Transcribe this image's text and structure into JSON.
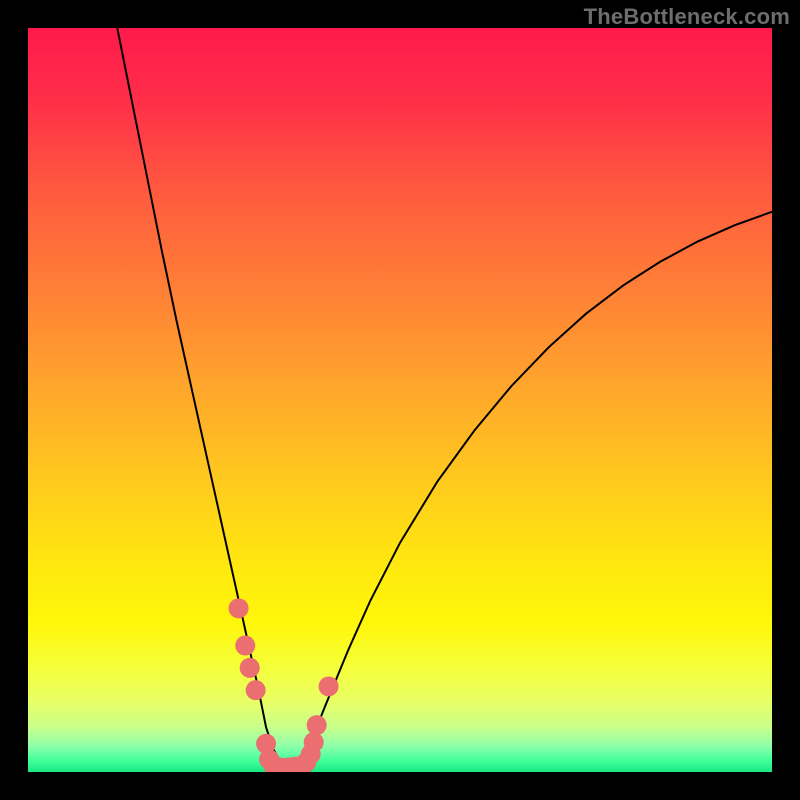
{
  "watermark": "TheBottleneck.com",
  "chart_data": {
    "type": "line",
    "title": "",
    "xlabel": "",
    "ylabel": "",
    "xlim": [
      0,
      100
    ],
    "ylim": [
      0,
      100
    ],
    "grid": false,
    "legend": false,
    "background_gradient": {
      "stops": [
        {
          "offset": 0.0,
          "color": "#ff1a4b"
        },
        {
          "offset": 0.1,
          "color": "#ff2f49"
        },
        {
          "offset": 0.22,
          "color": "#ff5a3f"
        },
        {
          "offset": 0.35,
          "color": "#ff7f36"
        },
        {
          "offset": 0.48,
          "color": "#ffa52c"
        },
        {
          "offset": 0.6,
          "color": "#ffc71f"
        },
        {
          "offset": 0.72,
          "color": "#ffe80f"
        },
        {
          "offset": 0.8,
          "color": "#fff70a"
        },
        {
          "offset": 0.86,
          "color": "#f5ff3a"
        },
        {
          "offset": 0.905,
          "color": "#e8ff66"
        },
        {
          "offset": 0.94,
          "color": "#c9ff8a"
        },
        {
          "offset": 0.965,
          "color": "#8fffaa"
        },
        {
          "offset": 0.985,
          "color": "#40ff9a"
        },
        {
          "offset": 1.0,
          "color": "#18e884"
        }
      ]
    },
    "series": [
      {
        "name": "bottleneck-curve",
        "color": "#000000",
        "x": [
          12.0,
          14.0,
          16.0,
          18.0,
          20.0,
          22.0,
          24.0,
          25.0,
          26.0,
          27.0,
          28.0,
          29.0,
          30.0,
          31.0,
          31.5,
          32.0,
          33.0,
          34.0,
          35.0,
          35.5,
          36.0,
          37.0,
          38.0,
          40.0,
          43.0,
          46.0,
          50.0,
          55.0,
          60.0,
          65.0,
          70.0,
          75.0,
          80.0,
          85.0,
          90.0,
          95.0,
          100.0
        ],
        "y": [
          100.0,
          90.0,
          80.0,
          70.0,
          60.5,
          51.5,
          42.5,
          38.0,
          33.5,
          29.0,
          24.5,
          20.0,
          15.5,
          11.0,
          8.5,
          6.0,
          3.0,
          1.3,
          0.3,
          0.0,
          0.3,
          1.8,
          4.0,
          9.0,
          16.3,
          23.0,
          30.8,
          39.0,
          45.9,
          51.9,
          57.1,
          61.6,
          65.4,
          68.6,
          71.3,
          73.5,
          75.3
        ]
      }
    ],
    "markers": {
      "name": "highlight-dots",
      "color": "#eb6e70",
      "radius_px": 10,
      "points": [
        {
          "x": 28.3,
          "y": 22.0
        },
        {
          "x": 29.2,
          "y": 17.0
        },
        {
          "x": 29.8,
          "y": 14.0
        },
        {
          "x": 30.6,
          "y": 11.0
        },
        {
          "x": 32.0,
          "y": 3.8
        },
        {
          "x": 32.4,
          "y": 1.7
        },
        {
          "x": 33.0,
          "y": 0.9
        },
        {
          "x": 34.0,
          "y": 0.6
        },
        {
          "x": 35.0,
          "y": 0.6
        },
        {
          "x": 35.8,
          "y": 0.7
        },
        {
          "x": 36.6,
          "y": 0.8
        },
        {
          "x": 37.4,
          "y": 1.3
        },
        {
          "x": 38.0,
          "y": 2.4
        },
        {
          "x": 38.4,
          "y": 4.0
        },
        {
          "x": 38.8,
          "y": 6.3
        },
        {
          "x": 40.4,
          "y": 11.5
        }
      ]
    }
  }
}
